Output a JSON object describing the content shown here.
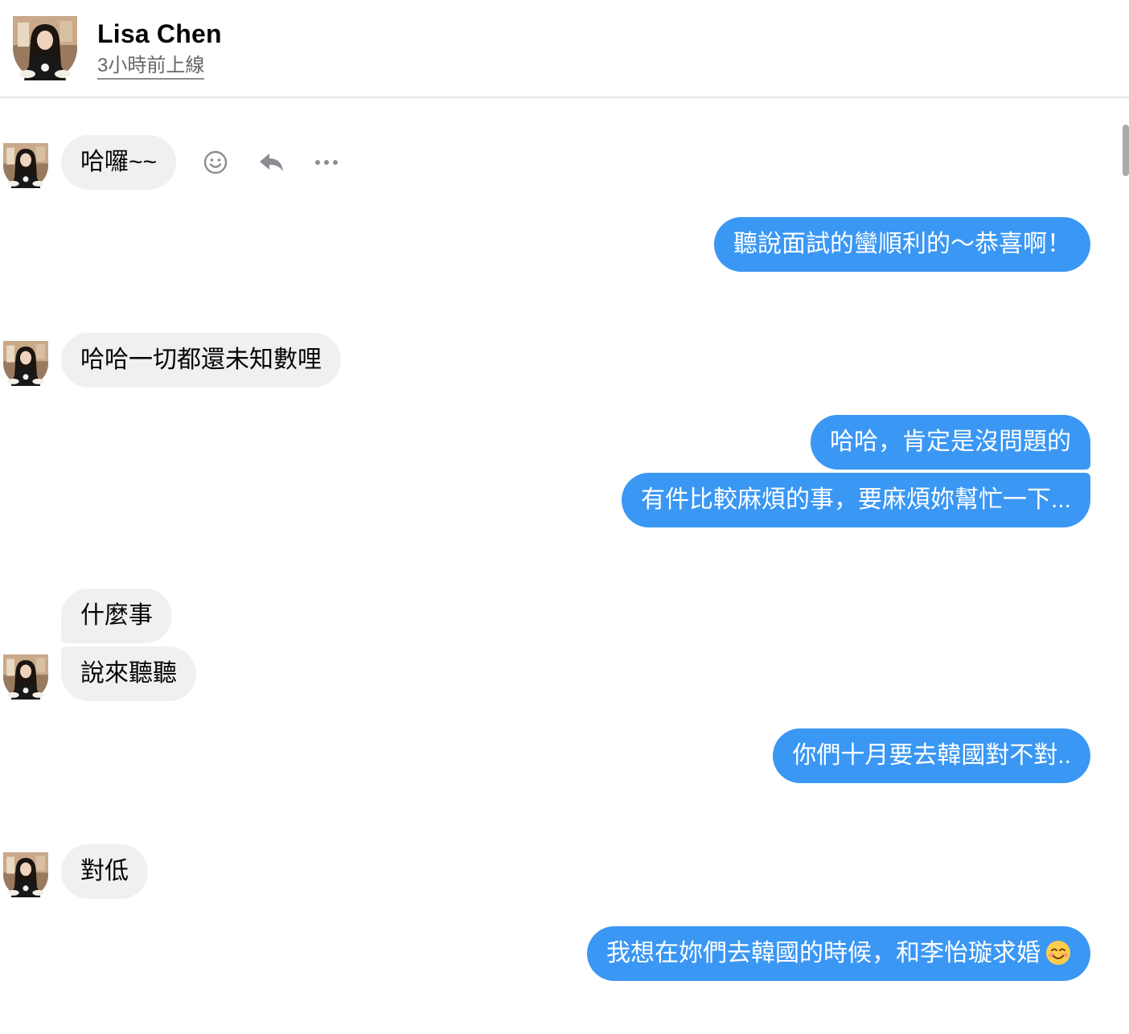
{
  "header": {
    "name": "Lisa Chen",
    "status": "3小時前上線"
  },
  "messages": [
    {
      "side": "in",
      "text": "哈囉~~"
    },
    {
      "side": "out",
      "text": "聽說面試的蠻順利的～恭喜啊！"
    },
    {
      "side": "in",
      "text": "哈哈一切都還未知數哩"
    },
    {
      "side": "out",
      "text": "哈哈，肯定是沒問題的"
    },
    {
      "side": "out",
      "text": "有件比較麻煩的事，要麻煩妳幫忙一下..."
    },
    {
      "side": "in",
      "text": "什麼事"
    },
    {
      "side": "in",
      "text": "說來聽聽"
    },
    {
      "side": "out",
      "text": "你們十月要去韓國對不對.."
    },
    {
      "side": "in",
      "text": "對低"
    },
    {
      "side": "out",
      "text": "我想在妳們去韓國的時候，和李怡璇求婚",
      "emoji": "smiling-face-emoji"
    }
  ],
  "message_actions": [
    "react-icon",
    "reply-icon",
    "more-icon"
  ],
  "colors": {
    "outgoing_bubble": "#3a97f4",
    "incoming_bubble": "#f0f0f0",
    "secondary_text": "#65676b"
  }
}
